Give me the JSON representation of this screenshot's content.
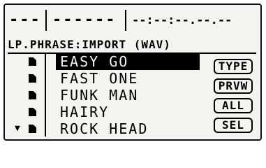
{
  "status_bar": {
    "segment_1": "---",
    "segment_2": "------",
    "segment_3": "--:--:--.--.--"
  },
  "screen_title": "LP.PHRASE:IMPORT (WAV)",
  "file_list": {
    "scroll_indicator": "▼",
    "items": [
      {
        "name": "EASY GO",
        "selected": true
      },
      {
        "name": "FAST ONE",
        "selected": false
      },
      {
        "name": "FUNK MAN",
        "selected": false
      },
      {
        "name": "HAIRY",
        "selected": false
      },
      {
        "name": "ROCK HEAD",
        "selected": false
      }
    ]
  },
  "side_buttons": {
    "type_label": "TYPE",
    "preview_label": "PRVW",
    "all_label": "ALL",
    "select_label": "SEL"
  }
}
